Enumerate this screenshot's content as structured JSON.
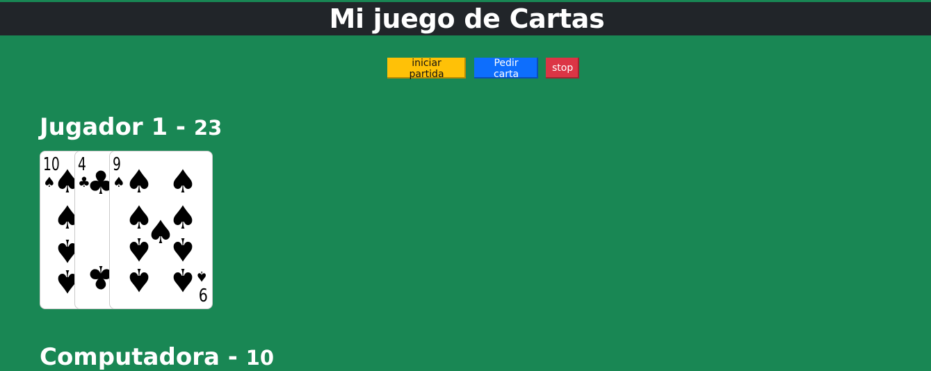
{
  "header": {
    "title": "Mi juego de Cartas"
  },
  "buttons": {
    "start": "iniciar partida",
    "pedir": "Pedir carta",
    "stop": "stop"
  },
  "jugador": {
    "name": "Jugador 1 - ",
    "points": "23"
  },
  "computadora": {
    "name": "Computadora - ",
    "points": "10"
  },
  "cards": [
    {
      "rank": "10",
      "suit": "♠",
      "suit_name": "spade"
    },
    {
      "rank": "4",
      "suit": "♣",
      "suit_name": "club"
    },
    {
      "rank": "9",
      "suit": "♠",
      "suit_name": "spade"
    }
  ],
  "colors": {
    "table": "#198754",
    "topbar": "#212529",
    "start": "#ffc107",
    "pedir": "#0d6efd",
    "stop": "#dc3545"
  }
}
